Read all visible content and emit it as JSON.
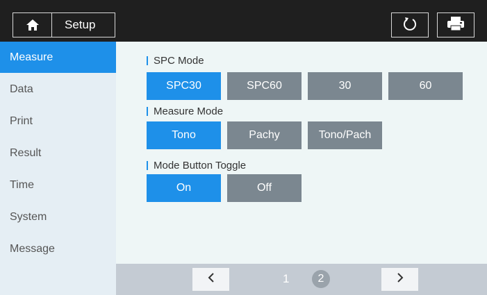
{
  "header": {
    "title": "Setup",
    "icons": {
      "home": "home-icon",
      "refresh": "refresh-icon",
      "print": "printer-icon"
    }
  },
  "sidebar": {
    "items": [
      {
        "label": "Measure",
        "active": true
      },
      {
        "label": "Data",
        "active": false
      },
      {
        "label": "Print",
        "active": false
      },
      {
        "label": "Result",
        "active": false
      },
      {
        "label": "Time",
        "active": false
      },
      {
        "label": "System",
        "active": false
      },
      {
        "label": "Message",
        "active": false
      }
    ]
  },
  "main": {
    "spc_mode": {
      "label": "SPC Mode",
      "options": [
        "SPC30",
        "SPC60",
        "30",
        "60"
      ],
      "selected": "SPC30"
    },
    "measure_mode": {
      "label": "Measure Mode",
      "options": [
        "Tono",
        "Pachy",
        "Tono/Pach"
      ],
      "selected": "Tono"
    },
    "mode_button_toggle": {
      "label": "Mode Button Toggle",
      "options": [
        "On",
        "Off"
      ],
      "selected": "On"
    }
  },
  "pagination": {
    "prev": "<",
    "next": ">",
    "pages": [
      "1",
      "2"
    ],
    "current": "2"
  },
  "colors": {
    "accent": "#1e90e9",
    "unselected": "#7b8790",
    "header_bg": "#1f1f1f",
    "sidebar_bg": "#e5eef4",
    "content_bg": "#eef6f6",
    "footer_bg": "#c4cbd3"
  }
}
